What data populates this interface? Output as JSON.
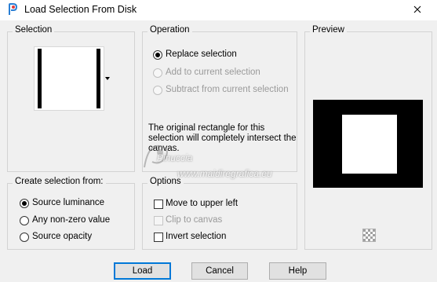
{
  "window": {
    "title": "Load Selection From Disk",
    "icon": "paintshop-pro-icon",
    "close_icon": "close-icon"
  },
  "selection_group": {
    "title": "Selection",
    "dropdown_icon": "chevron-down-icon"
  },
  "operation_group": {
    "title": "Operation",
    "options": [
      {
        "label": "Replace selection",
        "checked": true,
        "enabled": true
      },
      {
        "label": "Add to current selection",
        "checked": false,
        "enabled": false
      },
      {
        "label": "Subtract from current selection",
        "checked": false,
        "enabled": false
      }
    ],
    "info_text": "The original rectangle for this selection will completely intersect the canvas."
  },
  "preview_group": {
    "title": "Preview",
    "zoom_icon": "checker-pattern-icon"
  },
  "create_group": {
    "title": "Create selection from:",
    "options": [
      {
        "label": "Source luminance",
        "checked": true
      },
      {
        "label": "Any non-zero value",
        "checked": false
      },
      {
        "label": "Source opacity",
        "checked": false
      }
    ]
  },
  "options_group": {
    "title": "Options",
    "items": [
      {
        "label": "Move to upper left",
        "checked": false,
        "enabled": true
      },
      {
        "label": "Clip to canvas",
        "checked": false,
        "enabled": false
      },
      {
        "label": "Invert selection",
        "checked": false,
        "enabled": true
      }
    ]
  },
  "buttons": {
    "load": "Load",
    "cancel": "Cancel",
    "help": "Help"
  },
  "watermark": {
    "line1": "Pinuccia",
    "line2": "www.maidiregrafica.eu"
  },
  "colors": {
    "accent": "#0078d7",
    "dialog_bg": "#f0f0f0"
  }
}
